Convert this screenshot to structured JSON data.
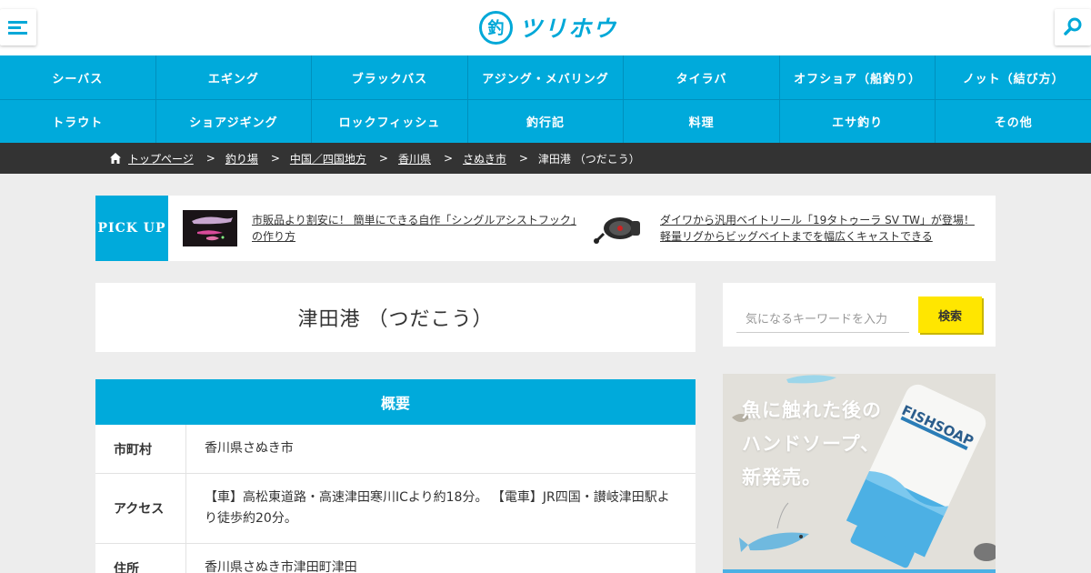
{
  "header": {
    "logo_mark": "釣",
    "logo_text": "ツリホウ"
  },
  "nav": {
    "row1": [
      "シーバス",
      "エギング",
      "ブラックバス",
      "アジング・メバリング",
      "タイラバ",
      "オフショア（船釣り）",
      "ノット（結び方）"
    ],
    "row2": [
      "トラウト",
      "ショアジギング",
      "ロックフィッシュ",
      "釣行記",
      "料理",
      "エサ釣り",
      "その他"
    ]
  },
  "breadcrumb": {
    "items": [
      "トップページ",
      "釣り場",
      "中国／四国地方",
      "香川県",
      "さぬき市"
    ],
    "current": "津田港 （つだこう）",
    "separator": ">"
  },
  "pickup": {
    "label": "PICK UP",
    "items": [
      {
        "text": "市販品より割安に！ 簡単にできる自作「シングルアシストフック」の作り方"
      },
      {
        "text": "ダイワから汎用ベイトリール「19タトゥーラ SV TW」が登場！軽量リグからビッグベイトまでを幅広くキャストできる"
      }
    ]
  },
  "article": {
    "title": "津田港 （つだこう）",
    "overview_heading": "概要",
    "rows": [
      {
        "key": "市町村",
        "value": "香川県さぬき市"
      },
      {
        "key": "アクセス",
        "value": "【車】高松東道路・高速津田寒川ICより約18分。 【電車】JR四国・讃岐津田駅より徒歩約20分。"
      },
      {
        "key": "住所",
        "value": "香川県さぬき市津田町津田"
      }
    ]
  },
  "sidebar": {
    "search_placeholder": "気になるキーワードを入力",
    "search_button": "検索",
    "ad": {
      "lines": [
        "魚に触れた後の",
        "ハンドソープ、",
        "新発売。"
      ],
      "product_label": "FISHSOAP"
    }
  },
  "colors": {
    "brand": "#00aadb",
    "breadcrumb_bg": "#333333",
    "search_button": "#ffe600",
    "page_bg": "#ededed"
  }
}
